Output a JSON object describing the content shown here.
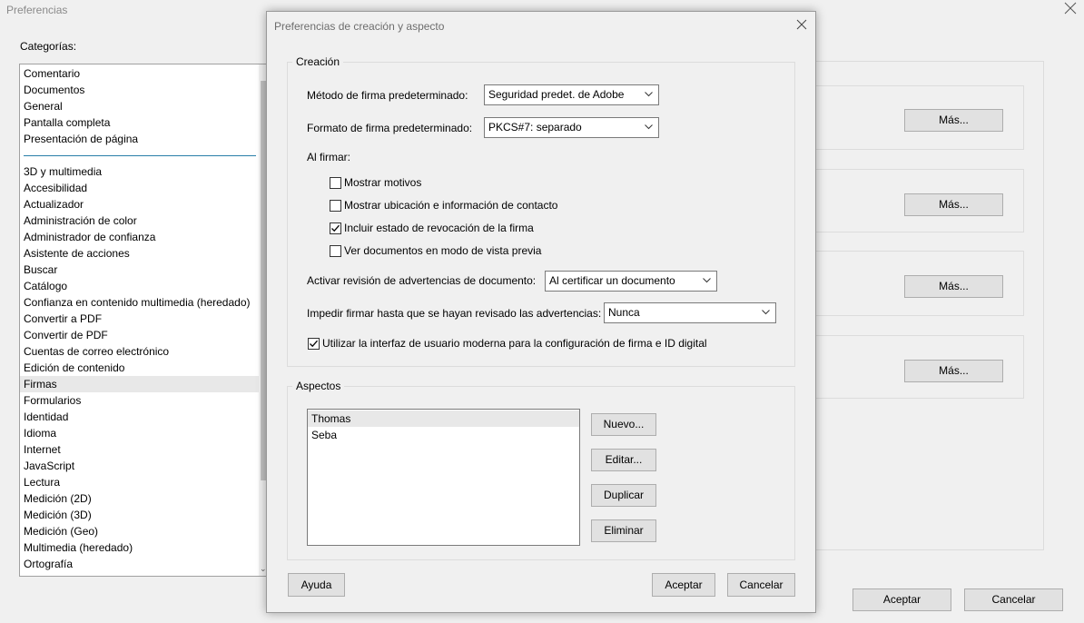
{
  "background": {
    "title": "Preferencias",
    "categories_label": "Categorías:",
    "categories_top": [
      "Comentario",
      "Documentos",
      "General",
      "Pantalla completa",
      "Presentación de página"
    ],
    "categories": [
      "3D y multimedia",
      "Accesibilidad",
      "Actualizador",
      "Administración de color",
      "Administrador de confianza",
      "Asistente de acciones",
      "Buscar",
      "Catálogo",
      "Confianza en contenido multimedia (heredado)",
      "Convertir a PDF",
      "Convertir de PDF",
      "Cuentas de correo electrónico",
      "Edición de contenido",
      "Firmas",
      "Formularios",
      "Identidad",
      "Idioma",
      "Internet",
      "JavaScript",
      "Lectura",
      "Medición (2D)",
      "Medición (3D)",
      "Medición (Geo)",
      "Multimedia (heredado)",
      "Ortografía"
    ],
    "selected_category": "Firmas",
    "more_buttons": [
      "Más...",
      "Más...",
      "Más...",
      "Más..."
    ],
    "ok_label": "Aceptar",
    "cancel_label": "Cancelar"
  },
  "dialog": {
    "title": "Preferencias de creación y aspecto",
    "creation": {
      "title": "Creación",
      "method_label": "Método de firma predeterminado:",
      "method_value": "Seguridad predet. de Adobe",
      "format_label": "Formato de firma predeterminado:",
      "format_value": "PKCS#7: separado",
      "when_signing_label": "Al firmar:",
      "checkboxes": [
        {
          "label": "Mostrar motivos",
          "checked": false
        },
        {
          "label": "Mostrar ubicación e información de contacto",
          "checked": false
        },
        {
          "label": "Incluir estado de revocación de la firma",
          "checked": true
        },
        {
          "label": "Ver documentos en modo de vista previa",
          "checked": false
        }
      ],
      "review_label": "Activar revisión de advertencias de documento:",
      "review_value": "Al certificar un documento",
      "prevent_label": "Impedir firmar hasta que se hayan revisado las advertencias:",
      "prevent_value": "Nunca",
      "modern_ui_label": "Utilizar la interfaz de usuario moderna para la configuración de firma e ID digital",
      "modern_ui_checked": true
    },
    "appearances": {
      "title": "Aspectos",
      "items": [
        "Thomas",
        "Seba"
      ],
      "selected": "Thomas",
      "new_label": "Nuevo...",
      "edit_label": "Editar...",
      "duplicate_label": "Duplicar",
      "delete_label": "Eliminar"
    },
    "help_label": "Ayuda",
    "ok_label": "Aceptar",
    "cancel_label": "Cancelar"
  }
}
